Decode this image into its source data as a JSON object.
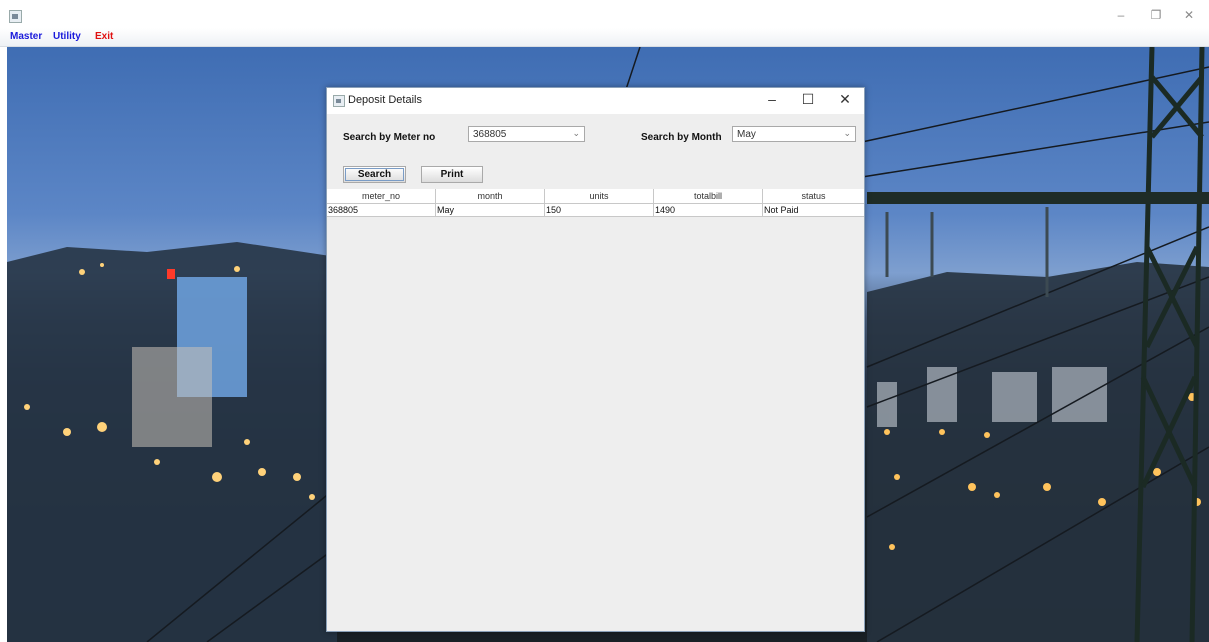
{
  "menu": {
    "master": "Master",
    "utility": "Utility",
    "exit": "Exit"
  },
  "main_window": {
    "controls": {
      "minimize": "–",
      "restore": "❐",
      "close": "✕"
    }
  },
  "dialog": {
    "title": "Deposit Details",
    "controls": {
      "minimize": "–",
      "maximize": "☐",
      "close": "✕"
    },
    "search_meter_label": "Search by Meter no",
    "meter_select_value": "368805",
    "search_month_label": "Search by Month",
    "month_select_value": "May",
    "search_button": "Search",
    "print_button": "Print",
    "table": {
      "columns": [
        "meter_no",
        "month",
        "units",
        "totalbill",
        "status"
      ],
      "rows": [
        [
          "368805",
          "May",
          "150",
          "1490",
          "Not Paid"
        ]
      ]
    }
  },
  "colors": {
    "menu_blue": "#1a1adb",
    "menu_red": "#e01010"
  }
}
